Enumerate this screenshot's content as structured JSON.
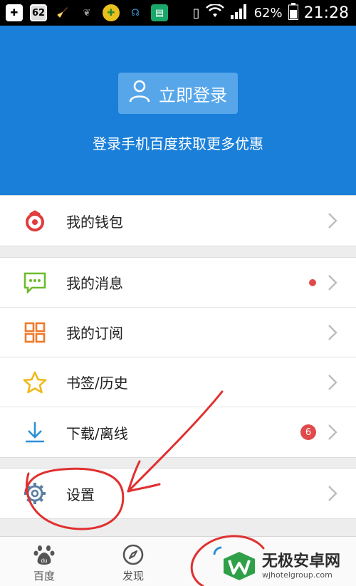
{
  "status_bar": {
    "battery": "62%",
    "time": "21:28",
    "app_icon_badge": "62"
  },
  "header": {
    "login_label": "立即登录",
    "login_subtitle": "登录手机百度获取更多优惠"
  },
  "groups": [
    {
      "items": [
        {
          "icon": "wallet-icon",
          "label": "我的钱包"
        }
      ]
    },
    {
      "items": [
        {
          "icon": "message-icon",
          "label": "我的消息",
          "dot": true
        },
        {
          "icon": "subscription-grid-icon",
          "label": "我的订阅"
        },
        {
          "icon": "star-icon",
          "label": "书签/历史"
        },
        {
          "icon": "download-icon",
          "label": "下载/离线",
          "badge": "6"
        }
      ]
    },
    {
      "items": [
        {
          "icon": "gear-icon",
          "label": "设置"
        }
      ]
    }
  ],
  "bottom_nav": [
    {
      "icon": "baidu-paw-icon",
      "label": "百度"
    },
    {
      "icon": "compass-icon",
      "label": "发现"
    }
  ],
  "watermark": {
    "name": "无极安卓网",
    "url": "wjhotelgroup.com"
  },
  "colors": {
    "header_blue": "#1a7fd9",
    "login_button": "#57a6ea",
    "badge_red": "#e04a4a",
    "annotation_red": "#e03030"
  }
}
